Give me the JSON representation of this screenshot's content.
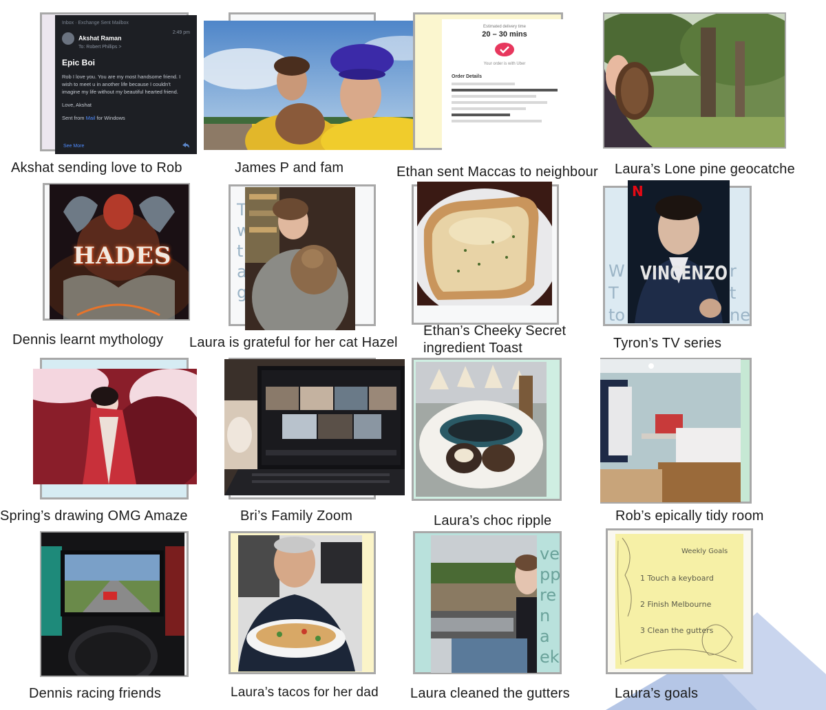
{
  "captions": {
    "c1": "Akshat sending love to Rob",
    "c2": "James P and fam",
    "c3": "Ethan sent Maccas to neighbour",
    "c4": "Laura’s Lone pine geocatche",
    "c5": "Dennis learnt mythology",
    "c6": "Laura is grateful for her cat Hazel",
    "c7": "Ethan’s Cheeky Secret ingredient Toast",
    "c8": "Tyron’s TV series",
    "c9": "Spring’s drawing OMG Amaze",
    "c10": "Bri’s Family Zoom",
    "c11": "Laura’s choc ripple",
    "c12": "Rob’s epically tidy room",
    "c13": "Dennis racing friends",
    "c14": "Laura’s tacos for her dad",
    "c15": "Laura cleaned the gutters",
    "c16": "Laura’s goals"
  },
  "email": {
    "header": "Inbox · Exchange Sent Mailbox",
    "sender": "Akshat Raman",
    "to": "To: Robert Phillips >",
    "time": "2:49 pm",
    "subject": "Epic Boi",
    "body": "Rob I love you. You are my most handsome friend. I wish to meet u in another life because I couldn't imagine my life without my beautiful hearted friend.",
    "signoff": "Love, Akshat",
    "sent_prefix": "Sent from",
    "sent_link": "Mail",
    "sent_suffix": "for Windows",
    "see_more": "See More"
  },
  "receipt": {
    "eta_label": "Estimated delivery time",
    "eta": "20 – 30 mins",
    "status": "Your order is with Uber",
    "details_title": "Order Details"
  },
  "posters": {
    "hades": "HADES",
    "vincenzo": "VINCENZO",
    "netflix_logo": "N"
  },
  "note": {
    "title": "Weekly Goals",
    "items": [
      "1 Touch a keyboard",
      "2 Finish Melbourne",
      "3 Clean the gutters"
    ]
  },
  "colors": {
    "frame_border": "#a8a8a8",
    "deco_triangle": "#c9d5ee",
    "note_yellow": "#f6f0a6"
  }
}
